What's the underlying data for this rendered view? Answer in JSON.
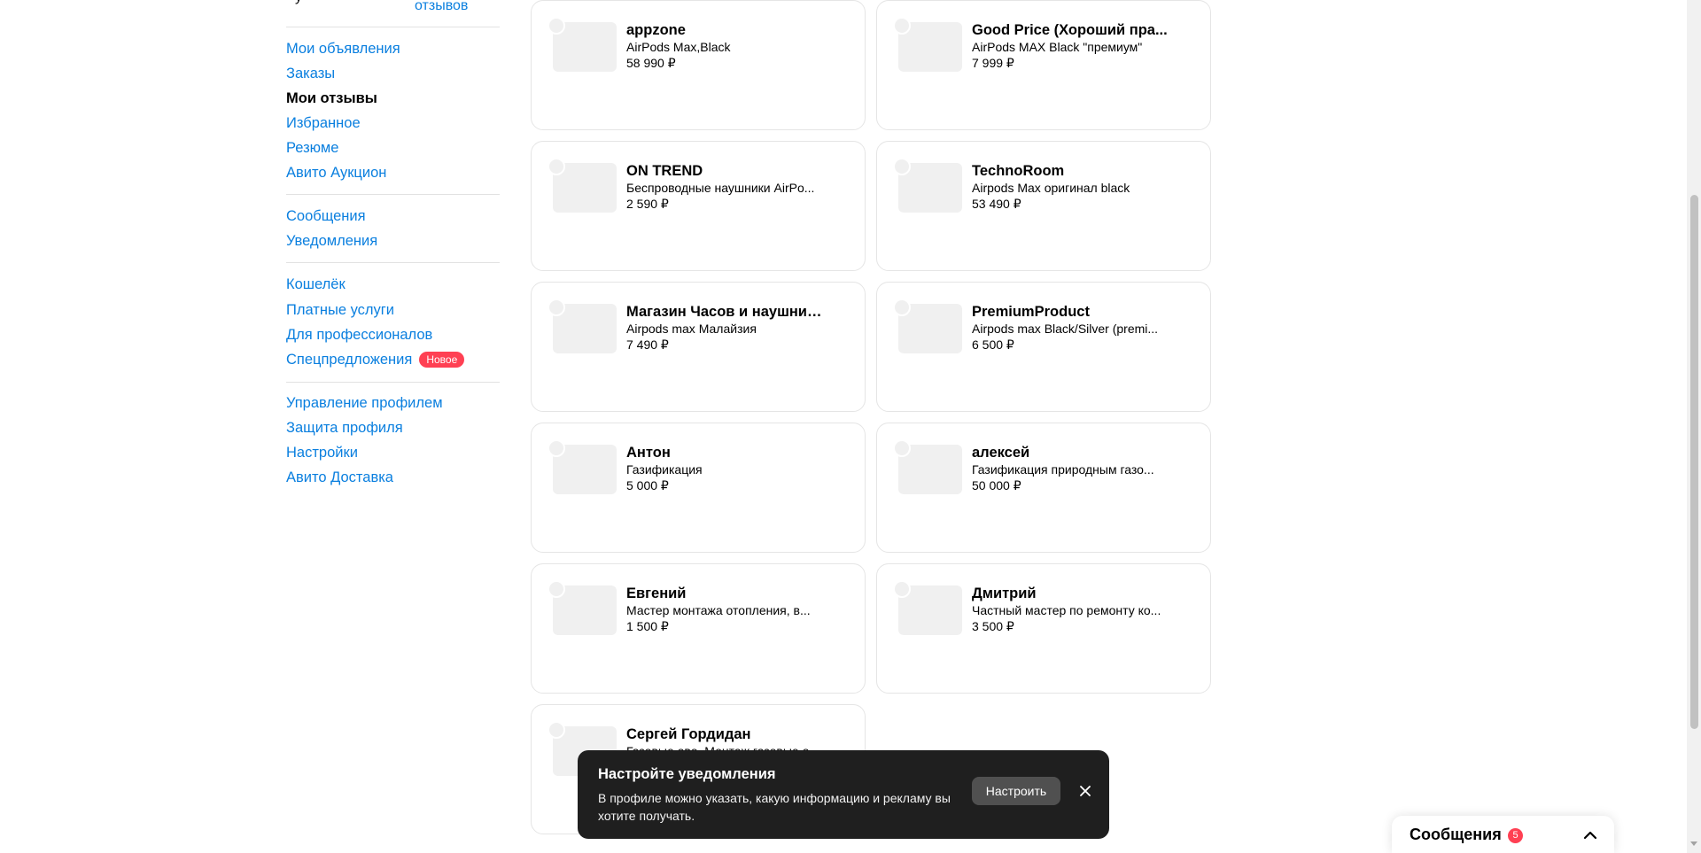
{
  "sidebar": {
    "top_cut_char": "у",
    "reviews_link": "отзывов",
    "groups": [
      [
        "Мои объявления",
        "Заказы",
        "Мои отзывы",
        "Избранное",
        "Резюме",
        "Авито Аукцион"
      ],
      [
        "Сообщения",
        "Уведомления"
      ],
      [
        "Кошелёк",
        "Платные услуги",
        "Для профессионалов",
        "Спецпредложения"
      ],
      [
        "Управление профилем",
        "Защита профиля",
        "Настройки",
        "Авито Доставка"
      ]
    ],
    "active_item": "Мои отзывы",
    "new_badge": "Новое",
    "colors": {
      "link": "#0a7fdf",
      "badge": "#ff4053"
    }
  },
  "cards": [
    {
      "name": "appzone",
      "desc": "AirPods Max,Black",
      "price": "58 990 ₽"
    },
    {
      "name": "Good Price (Хороший пра...",
      "desc": "AirPods MAX Black \"премиум\"",
      "price": "7 999 ₽"
    },
    {
      "name": "ON TREND",
      "desc": "Беспроводные наушники AirPo...",
      "price": "2 590 ₽"
    },
    {
      "name": "TechnoRoom",
      "desc": "Airpods Max оригинал black",
      "price": "53 490 ₽"
    },
    {
      "name": "Магазин Часов и наушник...",
      "desc": "Airpods max Малайзия",
      "price": "7 490 ₽"
    },
    {
      "name": "PremiumProduct",
      "desc": "Airpods max Black/Silver (premi...",
      "price": "6 500 ₽"
    },
    {
      "name": "Антон",
      "desc": "Газификация",
      "price": "5 000 ₽"
    },
    {
      "name": "алексей",
      "desc": "Газификация природным газо...",
      "price": "50 000 ₽"
    },
    {
      "name": "Евгений",
      "desc": "Мастер монтажа отопления, в...",
      "price": "1 500 ₽"
    },
    {
      "name": "Дмитрий",
      "desc": "Частный мастер по ремонту ко...",
      "price": "3 500 ₽"
    },
    {
      "name": "Сергей Гордидан",
      "desc": "Газовые ово. Монтаж газовые о...",
      "price": ""
    }
  ],
  "toast": {
    "title": "Настройте уведомления",
    "text": "В профиле можно указать, какую информацию и рекламу вы хотите получать.",
    "button": "Настроить",
    "close_icon": "close-icon"
  },
  "messages_widget": {
    "title": "Сообщения",
    "count": "5",
    "chevron_icon": "chevron-up-icon"
  }
}
